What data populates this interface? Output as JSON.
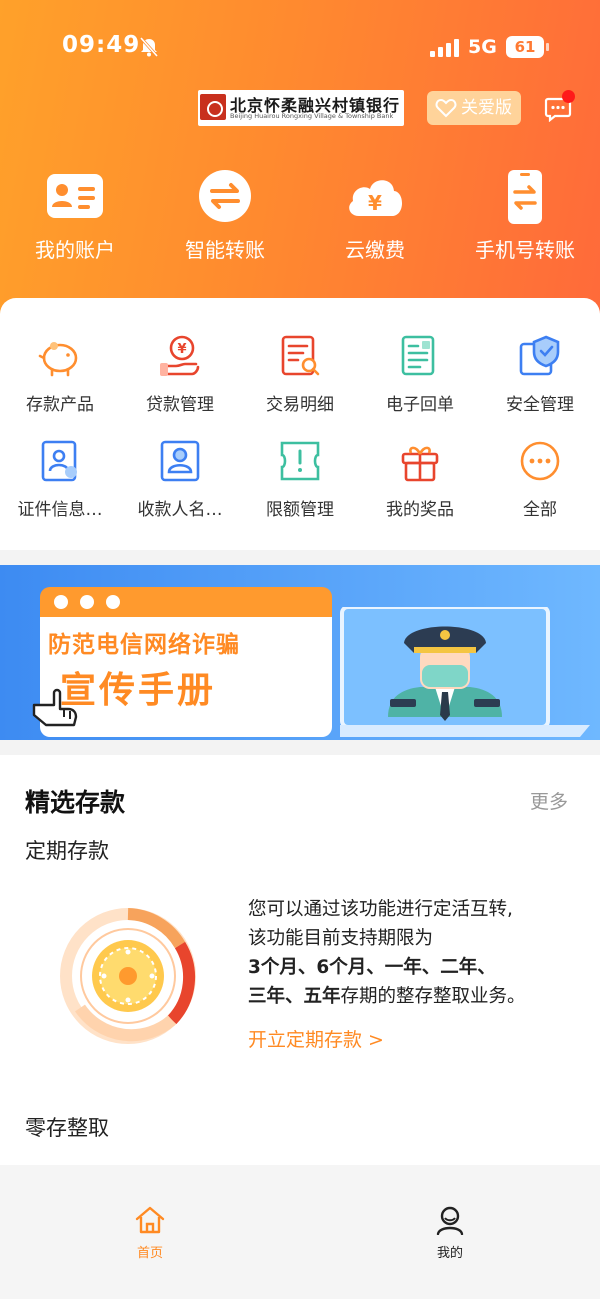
{
  "status_bar": {
    "time": "09:49",
    "network": "5G",
    "battery": "61"
  },
  "header": {
    "bank_name_cn": "北京怀柔融兴村镇银行",
    "bank_name_en": "Beijing Huairou Rongxing Village & Township Bank",
    "care_mode_label": "关爱版",
    "colors": {
      "gradient_start": "#ffa12a",
      "gradient_end": "#ff6a3a"
    }
  },
  "quick_actions": [
    {
      "label": "我的账户",
      "icon": "account-card-icon"
    },
    {
      "label": "智能转账",
      "icon": "transfer-arrows-icon"
    },
    {
      "label": "云缴费",
      "icon": "cloud-yuan-icon"
    },
    {
      "label": "手机号转账",
      "icon": "phone-transfer-icon"
    }
  ],
  "services": [
    {
      "label": "存款产品",
      "icon": "piggy-bank-icon"
    },
    {
      "label": "贷款管理",
      "icon": "loan-hand-icon"
    },
    {
      "label": "交易明细",
      "icon": "transaction-detail-icon"
    },
    {
      "label": "电子回单",
      "icon": "e-receipt-icon"
    },
    {
      "label": "安全管理",
      "icon": "shield-icon"
    },
    {
      "label": "证件信息…",
      "icon": "id-card-icon"
    },
    {
      "label": "收款人名…",
      "icon": "payee-icon"
    },
    {
      "label": "限额管理",
      "icon": "limit-ticket-icon"
    },
    {
      "label": "我的奖品",
      "icon": "gift-icon"
    },
    {
      "label": "全部",
      "icon": "more-dots-icon"
    }
  ],
  "banner": {
    "line1": "防范电信网络诈骗",
    "line2": "宣传手册"
  },
  "featured": {
    "title": "精选存款",
    "more": "更多",
    "fixed": {
      "title": "定期存款",
      "desc_line1": "您可以通过该功能进行定活互转,",
      "desc_line2": "该功能目前支持期限为",
      "desc_line3": "3个月、6个月、一年、二年、",
      "desc_line4_bold": "三年、五年",
      "desc_line4_rest": "存期的整存整取业务。",
      "link": "开立定期存款 >"
    },
    "next_title": "零存整取"
  },
  "tabbar": [
    {
      "label": "首页",
      "active": true,
      "icon": "home-icon"
    },
    {
      "label": "我的",
      "active": false,
      "icon": "user-icon"
    }
  ],
  "accent_color": "#ff8a23"
}
